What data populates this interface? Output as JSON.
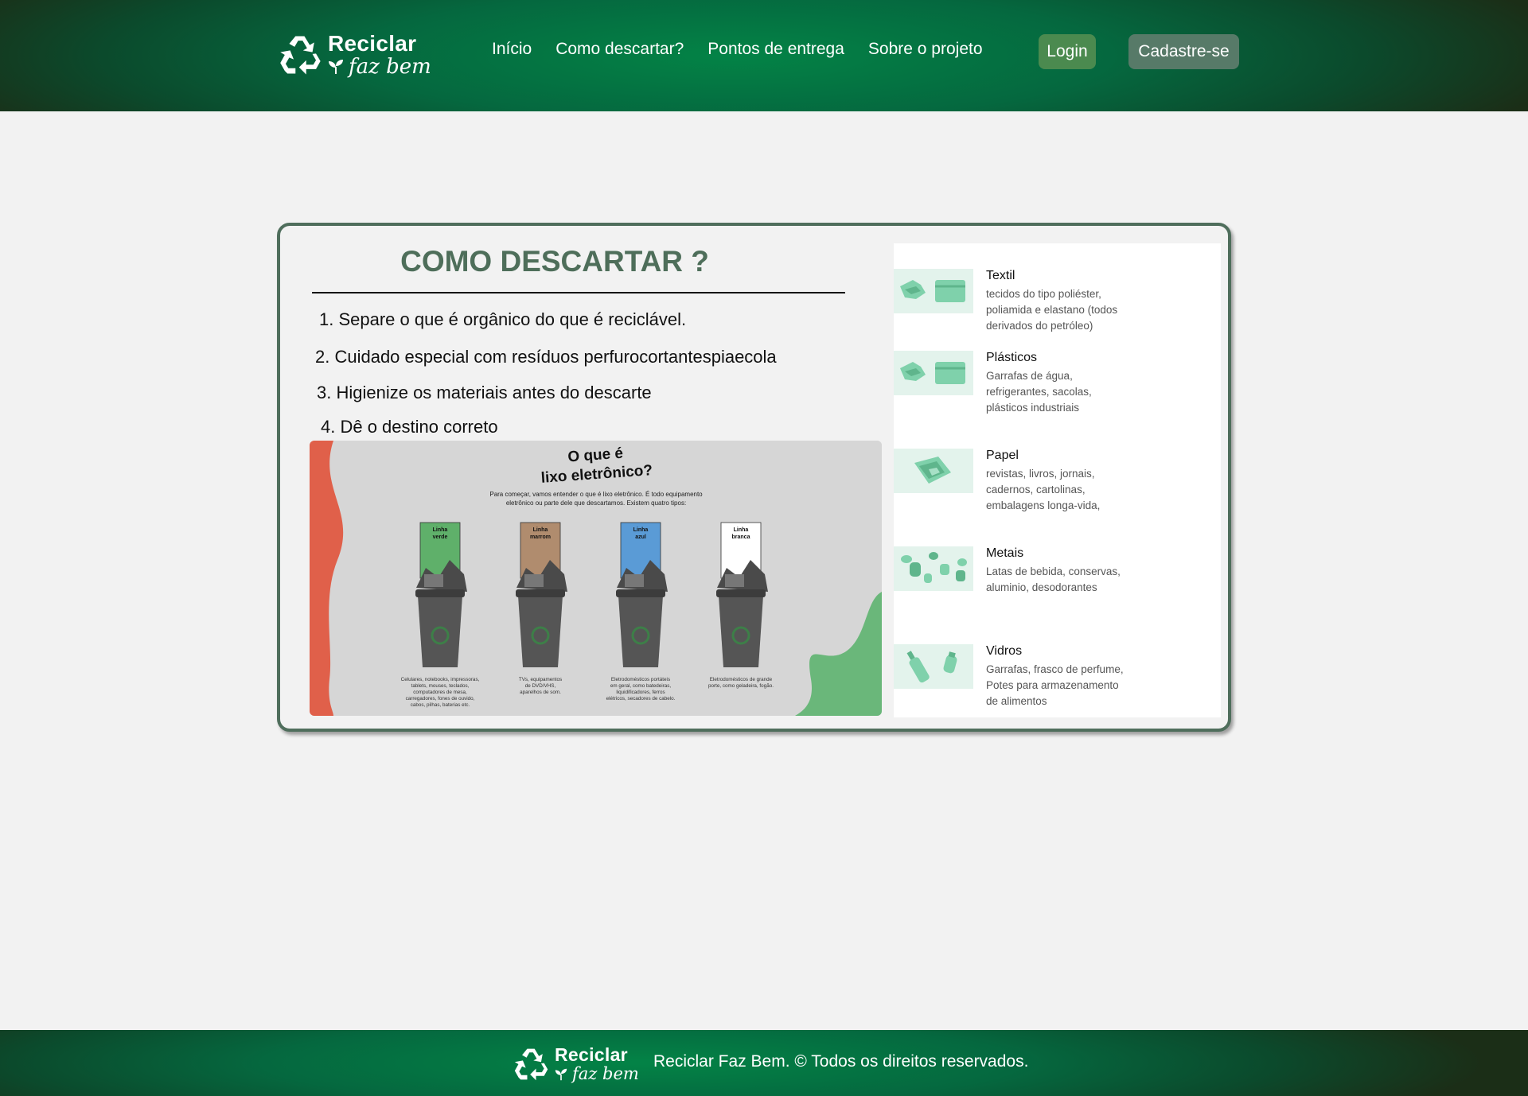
{
  "brand": {
    "line1": "Reciclar",
    "line2": "faz bem"
  },
  "nav": {
    "items": [
      {
        "label": "Início"
      },
      {
        "label": "Como descartar?"
      },
      {
        "label": "Pontos de entrega"
      },
      {
        "label": "Sobre o projeto"
      }
    ],
    "login_label": "Login",
    "signup_label": "Cadastre-se"
  },
  "main": {
    "title": "COMO DESCARTAR ?",
    "steps": [
      "1. Separe o que é orgânico do que é reciclável.",
      "2. Cuidado especial com resíduos perfurocortantespiaecola",
      "3. Higienize os materiais antes do descarte",
      "4. Dê o destino correto"
    ]
  },
  "infographic": {
    "title_line1": "O que é",
    "title_line2": "lixo eletrônico?",
    "intro_line1": "Para começar, vamos entender o que é lixo eletrônico. É todo equipamento",
    "intro_line2": "eletrônico ou parte dele que descartamos. Existem quatro tipos:",
    "bins": [
      {
        "label_line1": "Linha",
        "label_line2": "verde",
        "color": "#5fb06a",
        "caption": [
          "Celulares, notebooks, impressoras,",
          "tablets, mouses, teclados,",
          "computadores de mesa,",
          "carregadores, fones de ouvido,",
          "cabos, pilhas, baterias etc."
        ]
      },
      {
        "label_line1": "Linha",
        "label_line2": "marrom",
        "color": "#b08c6e",
        "caption": [
          "TVs, equipamentos",
          "de DVD/VHS,",
          "aparelhos de som."
        ]
      },
      {
        "label_line1": "Linha",
        "label_line2": "azul",
        "color": "#5a9bd6",
        "caption": [
          "Eletrodomésticos portáteis",
          "em geral, como batedeiras,",
          "liquidificadores, ferros",
          "elétricos, secadores de cabelo."
        ]
      },
      {
        "label_line1": "Linha",
        "label_line2": "branca",
        "color": "#ffffff",
        "caption": [
          "Eletrodomésticos de grande",
          "porte, como geladeira, fogão."
        ]
      }
    ]
  },
  "materials": [
    {
      "name": "Textil",
      "icon": "clothes-icon",
      "desc": [
        "tecidos do tipo poliéster,",
        "poliamida e elastano (todos",
        "derivados do petróleo)"
      ]
    },
    {
      "name": "Plásticos",
      "icon": "clothes-icon",
      "desc": [
        "Garrafas de água,",
        "refrigerantes, sacolas,",
        "plásticos industriais"
      ]
    },
    {
      "name": "Papel",
      "icon": "paper-icon",
      "desc": [
        "revistas, livros, jornais,",
        "cadernos, cartolinas,",
        "embalagens longa-vida,"
      ]
    },
    {
      "name": "Metais",
      "icon": "cans-icon",
      "desc": [
        "Latas de bebida, conservas,",
        "aluminio, desodorantes"
      ]
    },
    {
      "name": "Vidros",
      "icon": "bottles-icon",
      "desc": [
        "Garrafas, frasco de perfume,",
        "Potes para armazenamento",
        "de alimentos"
      ]
    }
  ],
  "footer": {
    "copyright": "Reciclar Faz Bem. © Todos os direitos reservados."
  },
  "colors": {
    "header_green": "#05683f",
    "accent_title": "#4e6e5a",
    "login_bg": "#4b8a4f",
    "signup_bg": "#577a68",
    "material_tint": "#7fd1ab"
  }
}
